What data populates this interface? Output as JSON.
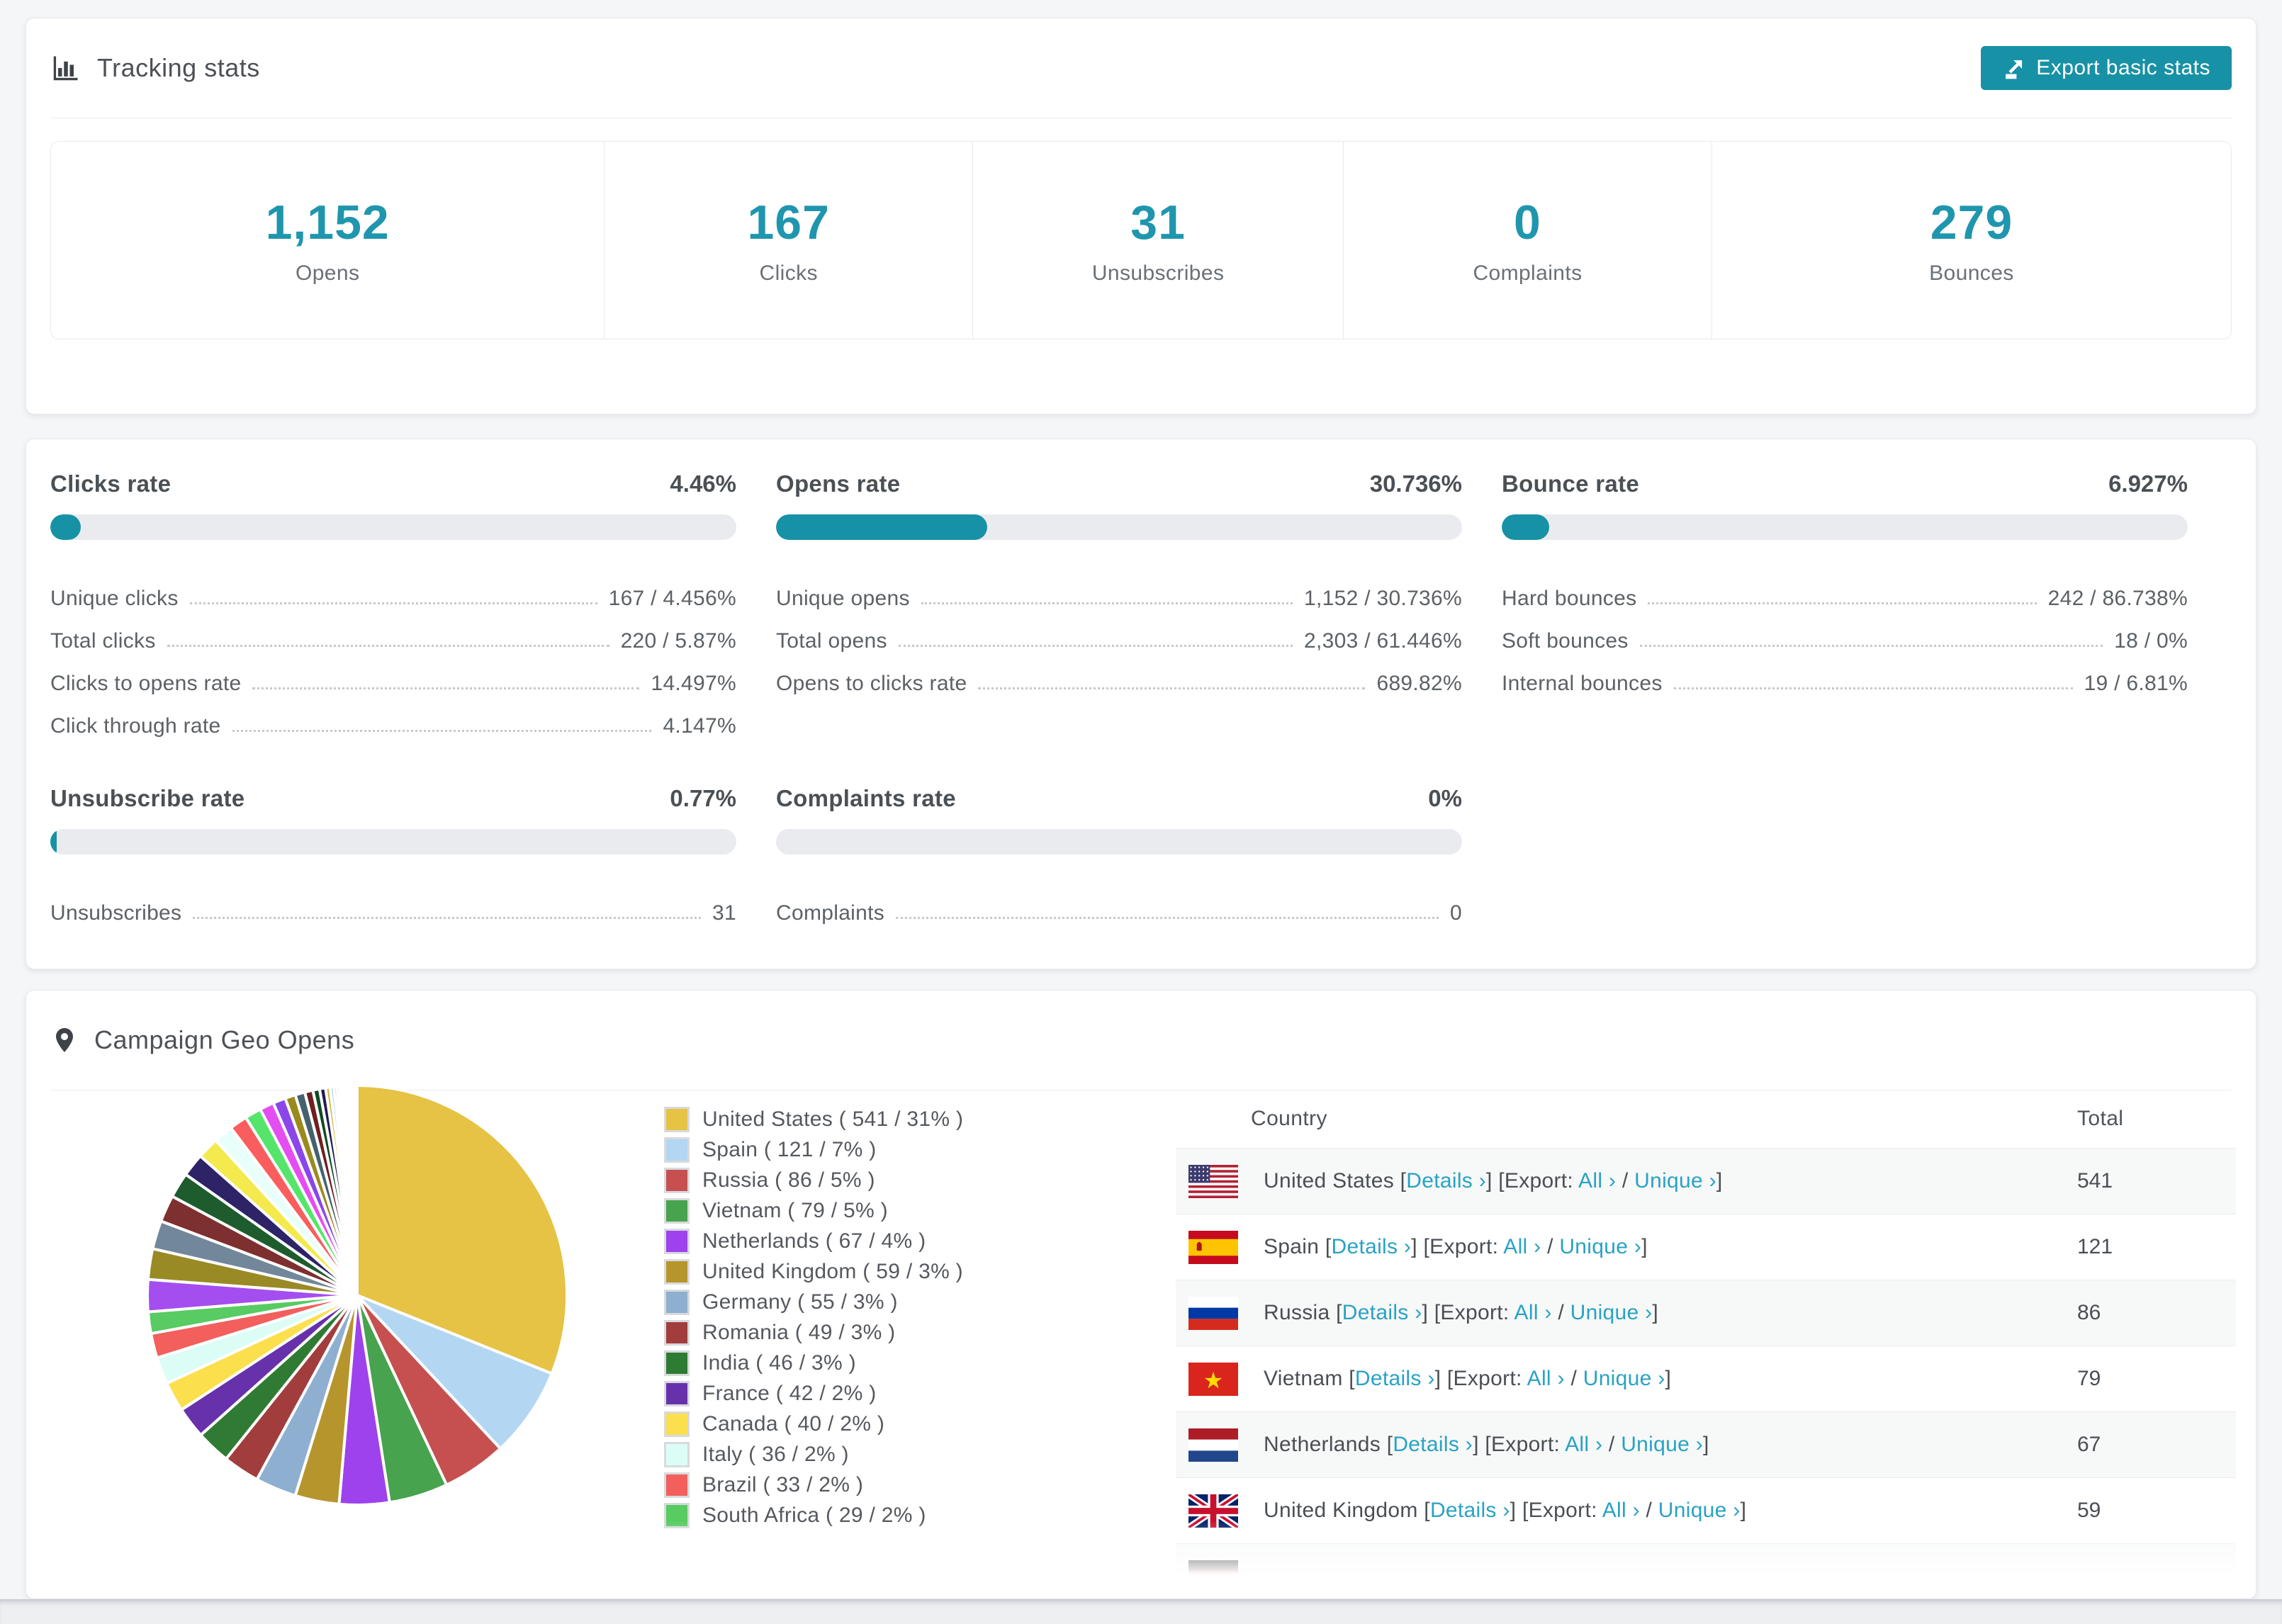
{
  "accent": "#1791a5",
  "link_color": "#29a2c4",
  "stat_number_color": "#1f96ae",
  "tracking": {
    "title": "Tracking stats",
    "export_label": "Export basic stats",
    "stats": [
      {
        "value": "1,152",
        "label": "Opens"
      },
      {
        "value": "167",
        "label": "Clicks"
      },
      {
        "value": "31",
        "label": "Unsubscribes"
      },
      {
        "value": "0",
        "label": "Complaints"
      },
      {
        "value": "279",
        "label": "Bounces"
      }
    ]
  },
  "rates": {
    "blocks": [
      {
        "title": "Clicks rate",
        "value": "4.46%",
        "fill_pct": 4.46,
        "rows": [
          {
            "label": "Unique clicks",
            "value": "167 / 4.456%"
          },
          {
            "label": "Total clicks",
            "value": "220 / 5.87%"
          },
          {
            "label": "Clicks to opens rate",
            "value": "14.497%"
          },
          {
            "label": "Click through rate",
            "value": "4.147%"
          }
        ]
      },
      {
        "title": "Opens rate",
        "value": "30.736%",
        "fill_pct": 30.736,
        "rows": [
          {
            "label": "Unique opens",
            "value": "1,152 / 30.736%"
          },
          {
            "label": "Total opens",
            "value": "2,303 / 61.446%"
          },
          {
            "label": "Opens to clicks rate",
            "value": "689.82%"
          }
        ]
      },
      {
        "title": "Bounce rate",
        "value": "6.927%",
        "fill_pct": 6.927,
        "rows": [
          {
            "label": "Hard bounces",
            "value": "242 / 86.738%"
          },
          {
            "label": "Soft bounces",
            "value": "18 / 0%"
          },
          {
            "label": "Internal bounces",
            "value": "19 / 6.81%"
          }
        ]
      },
      {
        "title": "Unsubscribe rate",
        "value": "0.77%",
        "fill_pct": 0.77,
        "rows": [
          {
            "label": "Unsubscribes",
            "value": "31"
          }
        ]
      },
      {
        "title": "Complaints rate",
        "value": "0%",
        "fill_pct": 0,
        "rows": [
          {
            "label": "Complaints",
            "value": "0"
          }
        ]
      }
    ]
  },
  "geo": {
    "title": "Campaign Geo Opens",
    "table_headers": {
      "country": "Country",
      "total": "Total"
    },
    "link_labels": {
      "details": "Details",
      "export": "Export:",
      "all": "All",
      "unique": "Unique"
    },
    "rows": [
      {
        "country": "United States",
        "total": "541",
        "flag": "us"
      },
      {
        "country": "Spain",
        "total": "121",
        "flag": "es"
      },
      {
        "country": "Russia",
        "total": "86",
        "flag": "ru"
      },
      {
        "country": "Vietnam",
        "total": "79",
        "flag": "vn"
      },
      {
        "country": "Netherlands",
        "total": "67",
        "flag": "nl"
      },
      {
        "country": "United Kingdom",
        "total": "59",
        "flag": "gb"
      }
    ],
    "partial_row_flag": "de"
  },
  "chart_data": {
    "type": "pie",
    "title": "Campaign Geo Opens",
    "legend_position": "right",
    "start_angle_deg": 0,
    "direction": "clockwise",
    "categories": [
      "United States",
      "Spain",
      "Russia",
      "Vietnam",
      "Netherlands",
      "United Kingdom",
      "Germany",
      "Romania",
      "India",
      "France",
      "Canada",
      "Italy",
      "Brazil",
      "South Africa"
    ],
    "values": [
      541,
      121,
      86,
      79,
      67,
      59,
      55,
      49,
      46,
      42,
      40,
      36,
      33,
      29
    ],
    "pcts": [
      31,
      7,
      5,
      5,
      4,
      3,
      3,
      3,
      3,
      2,
      2,
      2,
      2,
      2
    ],
    "colors": [
      "#e6c245",
      "#b3d6f2",
      "#c65050",
      "#47a34d",
      "#9d42ec",
      "#b6952c",
      "#8eafcf",
      "#a23d3d",
      "#2f7b33",
      "#6731ab",
      "#fbdf4d",
      "#dbfdf6",
      "#f25f5d",
      "#58cb62"
    ],
    "other_values": [
      43,
      41,
      38,
      36,
      34,
      31,
      29,
      26,
      24,
      22,
      19,
      17,
      14,
      13,
      11,
      9,
      8,
      6,
      5,
      4,
      4,
      3,
      3,
      2,
      2,
      2,
      2,
      1,
      1,
      1,
      1,
      1,
      1,
      1,
      1,
      1
    ],
    "other_colors": [
      "#a44ef0",
      "#998a25",
      "#72879a",
      "#7e2f2f",
      "#1e5c2e",
      "#2d2366",
      "#f4e94d",
      "#e9fffa",
      "#fa5d5d",
      "#55e56a",
      "#e44df2",
      "#8a46e8",
      "#9a8a1e",
      "#44616e",
      "#6e1f1f",
      "#0f4a22",
      "#221a52",
      "#d4b82e",
      "#a8d2f0",
      "#e03535",
      "#35b045",
      "#9535e0",
      "#c8a22e",
      "#88c4ea",
      "#f06060",
      "#66d877",
      "#e06ef0",
      "#7a52e8",
      "#b0a030",
      "#4a6a7a",
      "#8a3030",
      "#1a4a28",
      "#2a2258",
      "#e8d84a",
      "#bce0f8",
      "#f08080"
    ]
  }
}
